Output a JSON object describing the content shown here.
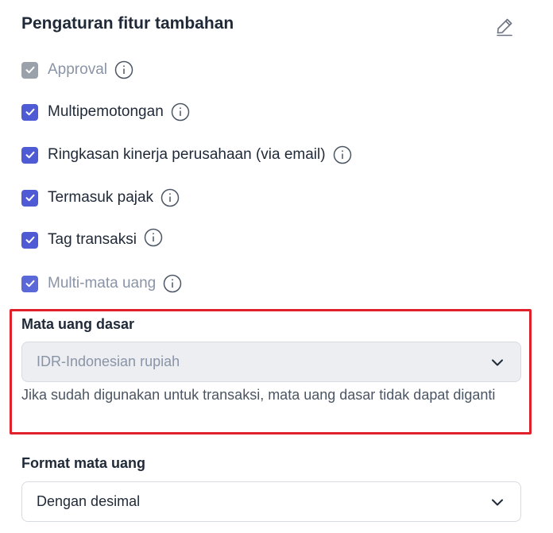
{
  "header": {
    "title": "Pengaturan fitur tambahan",
    "edit_icon": "pencil-icon"
  },
  "options": [
    {
      "key": "approval",
      "label": "Approval",
      "checked": true,
      "state": "disabled"
    },
    {
      "key": "multipemotongan",
      "label": "Multipemotongan",
      "checked": true,
      "state": "enabled"
    },
    {
      "key": "ringkasan",
      "label": "Ringkasan kinerja perusahaan (via email)",
      "checked": true,
      "state": "enabled"
    },
    {
      "key": "pajak",
      "label": "Termasuk pajak",
      "checked": true,
      "state": "enabled"
    },
    {
      "key": "tag",
      "label": "Tag transaksi",
      "checked": true,
      "state": "enabled"
    },
    {
      "key": "multi_mata_uang",
      "label": "Multi-mata uang",
      "checked": true,
      "state": "muted"
    }
  ],
  "base_currency": {
    "label": "Mata uang dasar",
    "value": "IDR-Indonesian rupiah",
    "helper": "Jika sudah digunakan untuk transaksi, mata uang dasar tidak dapat diganti"
  },
  "currency_format": {
    "label": "Format mata uang",
    "value": "Dengan desimal"
  },
  "colors": {
    "accent": "#4f5bd5",
    "highlight": "#e0202a",
    "disabled_check": "#9ba1ab"
  }
}
